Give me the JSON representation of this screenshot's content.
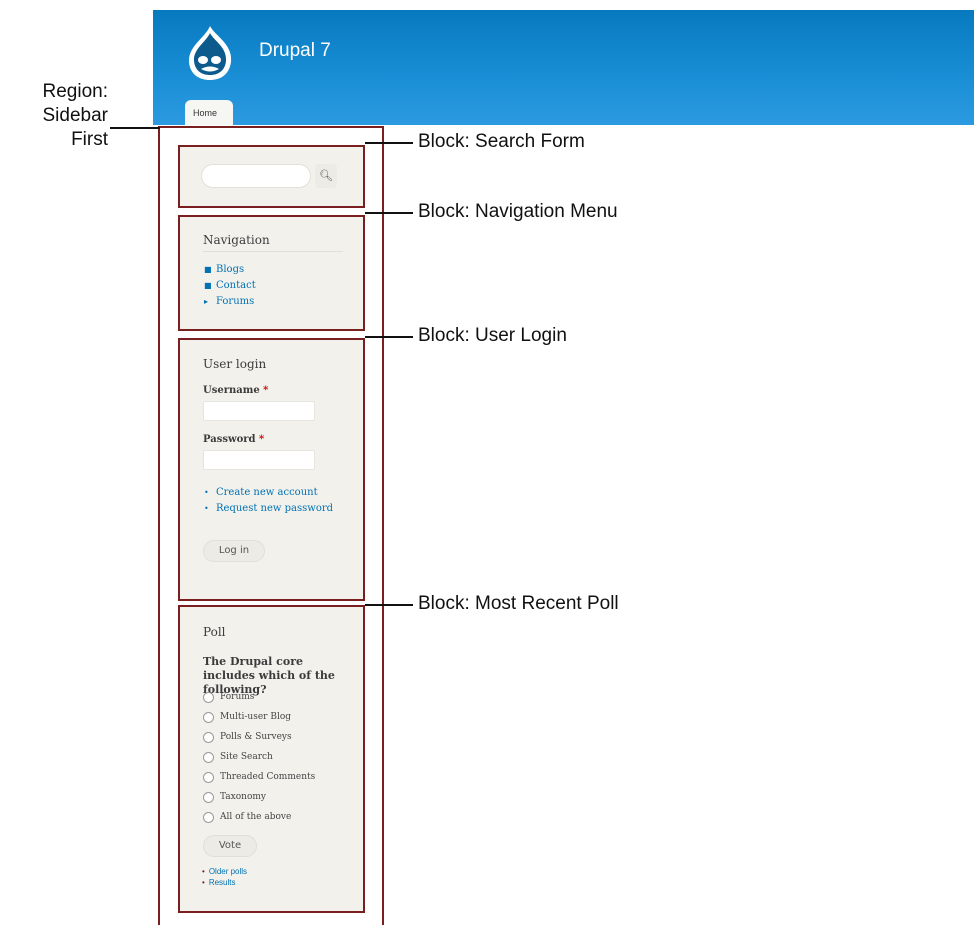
{
  "header": {
    "site_name": "Drupal 7",
    "tab_home": "Home",
    "brand_color": "#0779bf"
  },
  "annotations": {
    "region": "Region:",
    "region_name_1": "Sidebar",
    "region_name_2": "First",
    "search_block": "Block: Search Form",
    "navigation_block": "Block: Navigation Menu",
    "login_block": "Block: User Login",
    "poll_block": "Block: Most Recent Poll",
    "outline_color": "#7a1f1f"
  },
  "search": {
    "button_icon": "search-icon"
  },
  "navigation": {
    "title": "Navigation",
    "items": [
      "Blogs",
      "Contact",
      "Forums"
    ]
  },
  "login": {
    "title": "User login",
    "username_label": "Username",
    "password_label": "Password",
    "required_mark": "*",
    "links": [
      "Create new account",
      "Request new password"
    ],
    "button": "Log in"
  },
  "poll": {
    "title": "Poll",
    "question": "The Drupal core includes which of the following?",
    "choices": [
      "Forums",
      "Multi-user Blog",
      "Polls & Surveys",
      "Site Search",
      "Threaded Comments",
      "Taxonomy",
      "All of the above"
    ],
    "vote_button": "Vote",
    "links": [
      "Older polls",
      "Results"
    ]
  }
}
